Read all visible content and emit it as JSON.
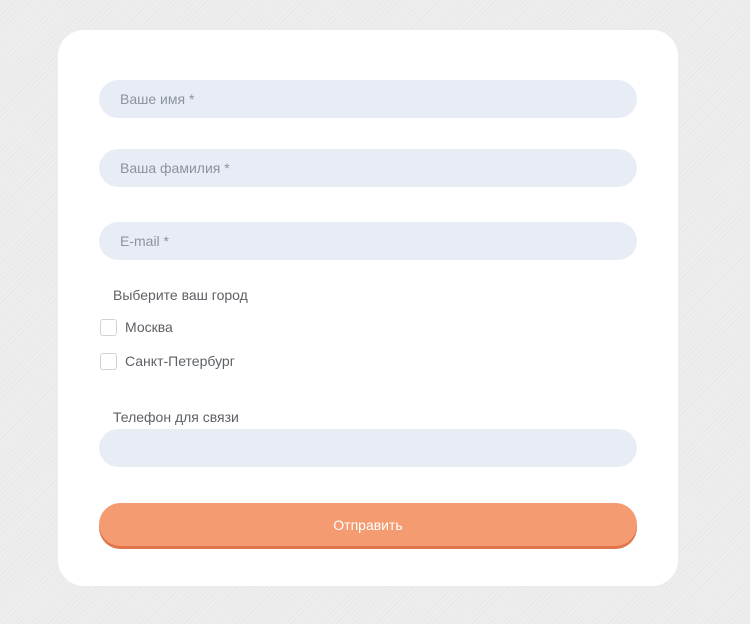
{
  "form": {
    "name_placeholder": "Ваше имя *",
    "surname_placeholder": "Ваша фамилия *",
    "email_placeholder": "E-mail *",
    "city_label": "Выберите ваш город",
    "cities": [
      {
        "label": "Москва",
        "checked": false
      },
      {
        "label": "Санкт-Петербург",
        "checked": false
      }
    ],
    "phone_label": "Телефон для связи",
    "phone_value": "",
    "submit_label": "Отправить"
  },
  "colors": {
    "page_background": "#ececec",
    "card_background": "#ffffff",
    "input_background": "#e8edf5",
    "button_background": "#f59b71",
    "button_shadow": "#e0774b",
    "text": "#5d6166",
    "placeholder": "#8d939a"
  }
}
